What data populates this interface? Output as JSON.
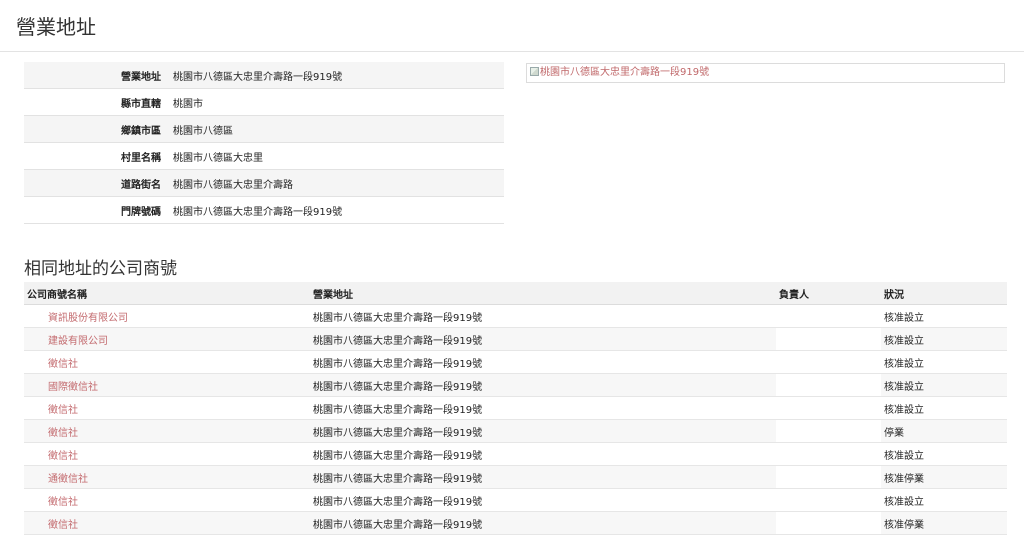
{
  "page_title": "營業地址",
  "address_details": [
    {
      "label": "營業地址",
      "value": "桃園市八德區大忠里介壽路一段919號"
    },
    {
      "label": "縣市直轄",
      "value": "桃園市"
    },
    {
      "label": "鄉鎮市區",
      "value": "桃園市八德區"
    },
    {
      "label": "村里名稱",
      "value": "桃園市八德區大忠里"
    },
    {
      "label": "道路街名",
      "value": "桃園市八德區大忠里介壽路"
    },
    {
      "label": "門牌號碼",
      "value": "桃園市八德區大忠里介壽路一段919號"
    }
  ],
  "map_image_alt": "桃園市八德區大忠里介壽路一段919號",
  "same_address_title": "相同地址的公司商號",
  "table_headers": {
    "name": "公司商號名稱",
    "address": "營業地址",
    "owner": "負責人",
    "status": "狀況"
  },
  "companies": [
    {
      "name": "資訊股份有限公司",
      "address": "桃園市八德區大忠里介壽路一段919號",
      "owner": "",
      "status": "核准設立"
    },
    {
      "name": "建設有限公司",
      "address": "桃園市八德區大忠里介壽路一段919號",
      "owner": "",
      "status": "核准設立"
    },
    {
      "name": "徵信社",
      "address": "桃園市八德區大忠里介壽路一段919號",
      "owner": "",
      "status": "核准設立"
    },
    {
      "name": "國際徵信社",
      "address": "桃園市八德區大忠里介壽路一段919號",
      "owner": "",
      "status": "核准設立"
    },
    {
      "name": "徵信社",
      "address": "桃園市八德區大忠里介壽路一段919號",
      "owner": "",
      "status": "核准設立"
    },
    {
      "name": "徵信社",
      "address": "桃園市八德區大忠里介壽路一段919號",
      "owner": "",
      "status": "停業"
    },
    {
      "name": "徵信社",
      "address": "桃園市八德區大忠里介壽路一段919號",
      "owner": "",
      "status": "核准設立"
    },
    {
      "name": "通徵信社",
      "address": "桃園市八德區大忠里介壽路一段919號",
      "owner": "",
      "status": "核准停業"
    },
    {
      "name": "徵信社",
      "address": "桃園市八德區大忠里介壽路一段919號",
      "owner": "",
      "status": "核准設立"
    },
    {
      "name": "徵信社",
      "address": "桃園市八德區大忠里介壽路一段919號",
      "owner": "",
      "status": "核准停業"
    }
  ]
}
